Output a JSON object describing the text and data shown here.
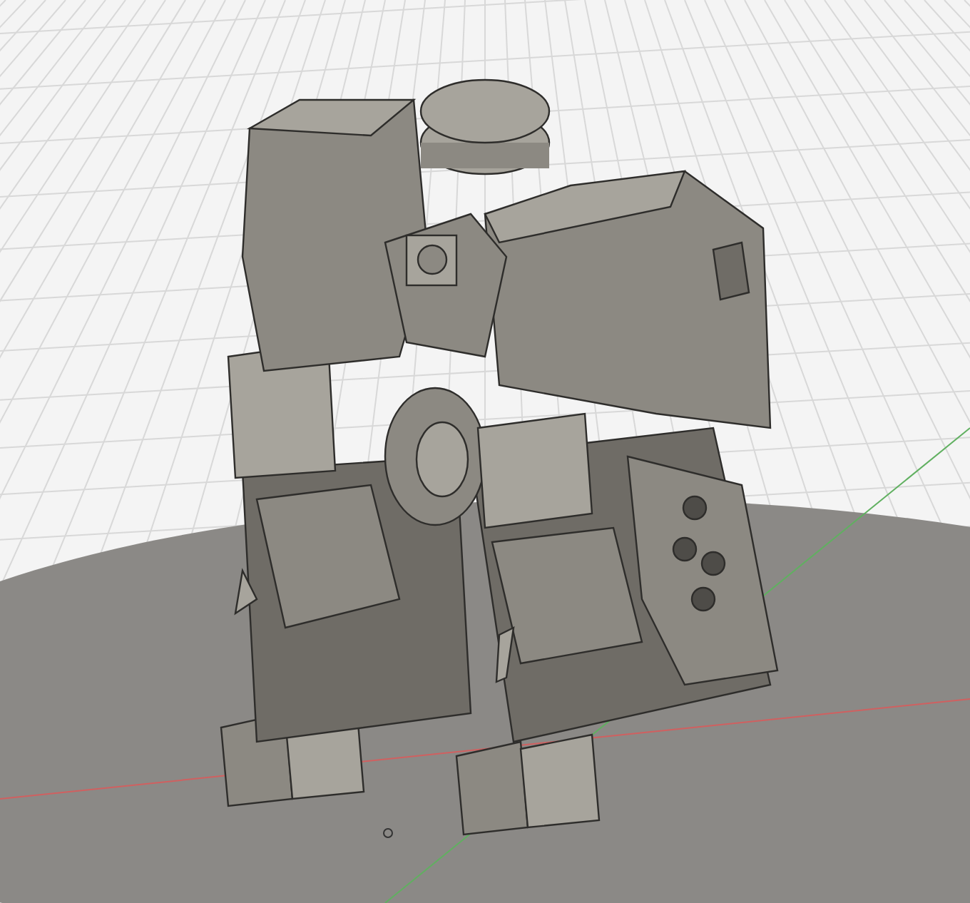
{
  "viewport": {
    "kind": "model-view",
    "axes_shown": true
  }
}
